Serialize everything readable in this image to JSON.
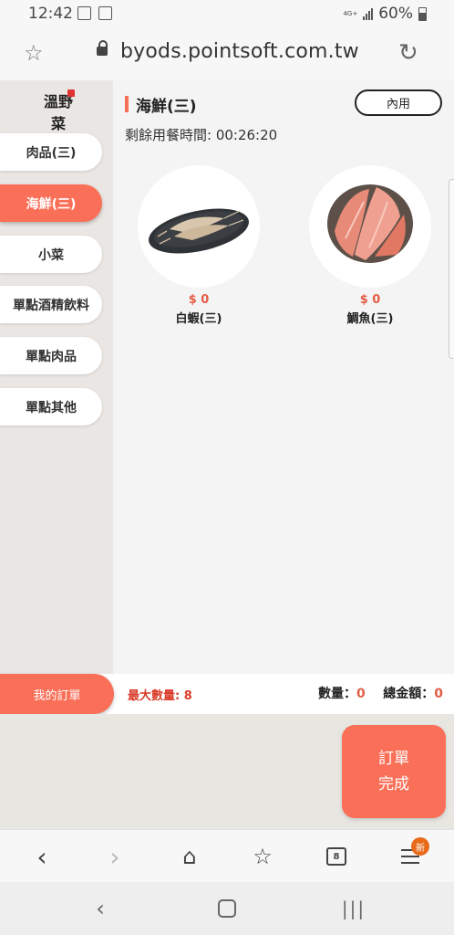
{
  "status_bar": {
    "time": "12:42",
    "network": "4G+",
    "battery": "60%"
  },
  "browser": {
    "url": "byods.pointsoft.com.tw"
  },
  "logo": {
    "text": "溫野菜"
  },
  "sidebar": {
    "categories": [
      {
        "label": "肉品(三)"
      },
      {
        "label": "海鮮(三)"
      },
      {
        "label": "小菜"
      },
      {
        "label": "單點酒精飲料"
      },
      {
        "label": "單點肉品"
      },
      {
        "label": "單點其他"
      }
    ],
    "active_index": 1
  },
  "main": {
    "section_title": "海鮮(三)",
    "dine_in_button": "內用",
    "time_remaining": "剩餘用餐時間: 00:26:20",
    "products": [
      {
        "name": "白蝦(三)",
        "price": "$ 0",
        "image": "white-shrimp-image"
      },
      {
        "name": "鯛魚(三)",
        "price": "$ 0",
        "image": "sea-bream-image"
      }
    ]
  },
  "footer": {
    "my_order_button": "我的訂單",
    "max_qty": "最大數量: 8",
    "qty_label": "數量：",
    "qty_value": "0",
    "total_label": "總金額：",
    "total_value": "0"
  },
  "complete_button": {
    "line1": "訂單",
    "line2": "完成"
  },
  "browser_nav": {
    "tabs_count": "8",
    "badge": "新"
  },
  "colors": {
    "accent": "#fa6f58",
    "price": "#e35d46",
    "warning_text": "#d93b2a"
  }
}
